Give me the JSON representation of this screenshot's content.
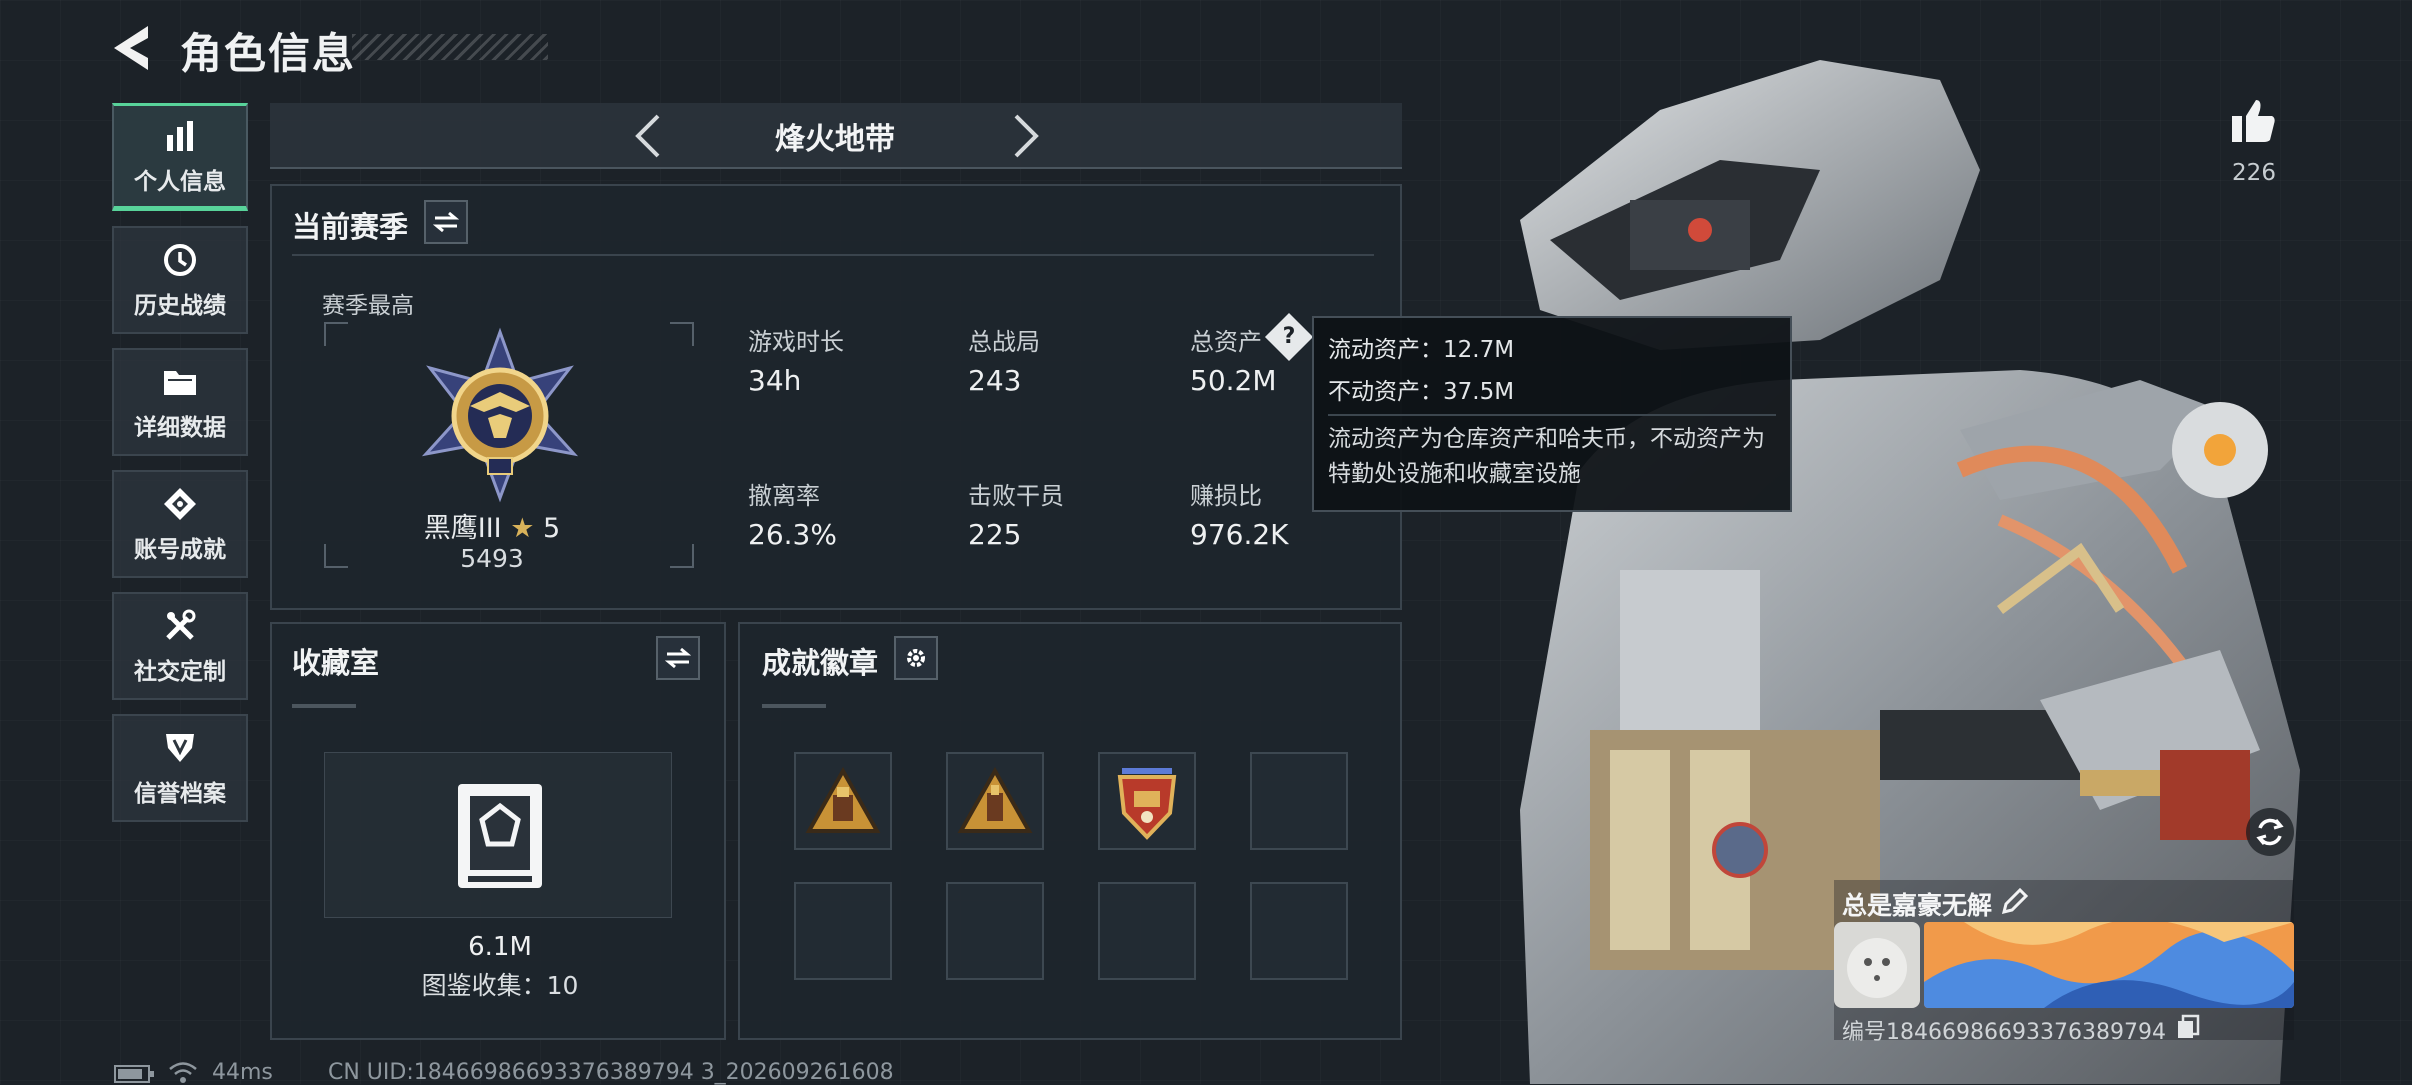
{
  "header": {
    "title": "角色信息"
  },
  "sidebar": {
    "items": [
      {
        "label": "个人信息",
        "icon": "bar-chart-icon",
        "active": true
      },
      {
        "label": "历史战绩",
        "icon": "history-clock-icon",
        "active": false
      },
      {
        "label": "详细数据",
        "icon": "folder-icon",
        "active": false
      },
      {
        "label": "账号成就",
        "icon": "achievement-icon",
        "active": false
      },
      {
        "label": "社交定制",
        "icon": "tools-icon",
        "active": false
      },
      {
        "label": "信誉档案",
        "icon": "shield-icon",
        "active": false
      }
    ]
  },
  "mode_selector": {
    "label": "烽火地带"
  },
  "season": {
    "title": "当前赛季",
    "best_label": "赛季最高",
    "rank_name": "黑鹰III",
    "rank_stars": "5",
    "rank_score": "5493",
    "stats": [
      {
        "label": "游戏时长",
        "value": "34h"
      },
      {
        "label": "总战局",
        "value": "243"
      },
      {
        "label": "总资产",
        "value": "50.2M"
      },
      {
        "label": "撤离率",
        "value": "26.3%"
      },
      {
        "label": "击败干员",
        "value": "225"
      },
      {
        "label": "赚损比",
        "value": "976.2K"
      }
    ]
  },
  "tooltip": {
    "line1": "流动资产：12.7M",
    "line2": "不动资产：37.5M",
    "desc": "流动资产为仓库资产和哈夫币，不动资产为特勤处设施和收藏室设施"
  },
  "collection": {
    "title": "收藏室",
    "value": "6.1M",
    "catalog": "图鉴收集：10"
  },
  "badges": {
    "title": "成就徽章",
    "filled": 3,
    "total": 8
  },
  "profile": {
    "likes": "226",
    "name": "总是嘉豪无解",
    "id_text": "编号18466986693376389794"
  },
  "status_bar": {
    "ping": "44ms",
    "uid": "CN UID:18466986693376389794 3_202609261608"
  },
  "colors": {
    "accent_green": "#58d39a",
    "gold": "#d8b25a",
    "background": "#1c2228"
  }
}
